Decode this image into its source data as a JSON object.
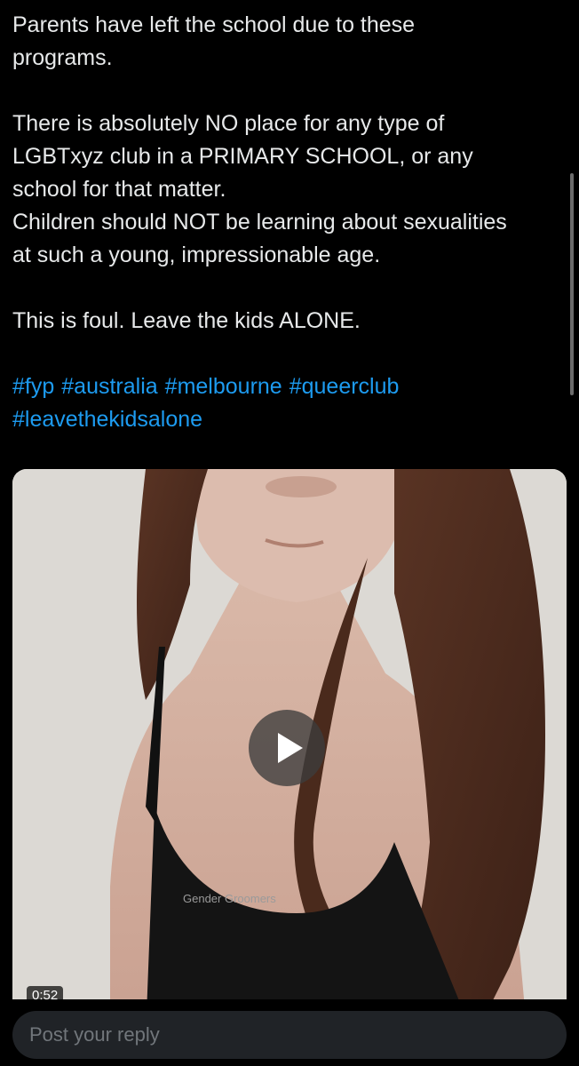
{
  "post": {
    "paragraphs": [
      [
        "Parents have left the school due to these",
        "programs."
      ],
      [
        "There is absolutely NO place for any type of",
        "LGBTxyz club in a PRIMARY SCHOOL, or any",
        "school for that matter.",
        "Children should NOT be learning about sexualities",
        "at such a young, impressionable age."
      ],
      [
        "This is foul. Leave the kids ALONE."
      ]
    ],
    "hashtags": [
      "#fyp",
      "#australia",
      "#melbourne",
      "#queerclub",
      "#leavethekidsalone"
    ]
  },
  "media": {
    "type": "video",
    "duration": "0:52",
    "shirt_text": "Gender Groomers",
    "play_icon": "play-icon"
  },
  "reply": {
    "placeholder": "Post your reply"
  },
  "colors": {
    "background": "#000000",
    "text": "#e7e9ea",
    "link": "#1d9bf0",
    "reply_field": "#202327",
    "placeholder": "#71767b"
  }
}
